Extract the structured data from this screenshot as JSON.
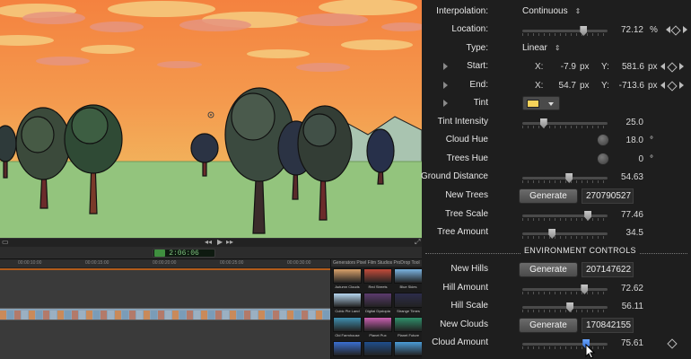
{
  "viewer": {
    "timecode": "2:06:06",
    "playback_controls": [
      "◂◂",
      "▶",
      "▸▸"
    ]
  },
  "timeline": {
    "ruler_labels": [
      "00:00:10:00",
      "00:00:15:00",
      "00:00:20:00",
      "00:00:25:00",
      "00:00:30:00"
    ]
  },
  "browser": {
    "header": "Generators   Pixel Film Studios   ProDrop Tool",
    "items": [
      {
        "label": "Autumn Clouds",
        "color": "#d9a16a"
      },
      {
        "label": "Red Streets",
        "color": "#c24b3a"
      },
      {
        "label": "Blue Skies",
        "color": "#7ab3e0"
      },
      {
        "label": "Cubic Pie Land",
        "color": "#b7d7f0"
      },
      {
        "label": "Digital Dystopia",
        "color": "#5b3b6e"
      },
      {
        "label": "Strange Times",
        "color": "#2c2c4a"
      },
      {
        "label": "Old Farmhouse",
        "color": "#3f8fb0"
      },
      {
        "label": "Planet Pux",
        "color": "#c95fb0"
      },
      {
        "label": "Planet Future",
        "color": "#2f8f6a"
      },
      {
        "label": "",
        "color": "#3a6fd0"
      },
      {
        "label": "",
        "color": "#1f4e8c"
      },
      {
        "label": "",
        "color": "#4a9bd6"
      }
    ]
  },
  "inspector": {
    "interpolation": {
      "label": "Interpolation:",
      "value": "Continuous"
    },
    "location": {
      "label": "Location:",
      "value": "72.12",
      "unit": "%",
      "fraction": 0.72
    },
    "type": {
      "label": "Type:",
      "value": "Linear"
    },
    "start": {
      "label": "Start:",
      "x_label": "X:",
      "x": "-7.9",
      "x_unit": "px",
      "y_label": "Y:",
      "y": "581.6",
      "y_unit": "px"
    },
    "end": {
      "label": "End:",
      "x_label": "X:",
      "x": "54.7",
      "x_unit": "px",
      "y_label": "Y:",
      "y": "-713.6",
      "y_unit": "px"
    },
    "tint": {
      "label": "Tint",
      "color": "#f7d35a"
    },
    "tint_intensity": {
      "label": "Tint Intensity",
      "value": "25.0",
      "fraction": 0.25
    },
    "cloud_hue": {
      "label": "Cloud Hue",
      "value": "18.0",
      "unit": "°"
    },
    "trees_hue": {
      "label": "Trees Hue",
      "value": "0",
      "unit": "°"
    },
    "ground_distance": {
      "label": "Ground Distance",
      "value": "54.63",
      "fraction": 0.55
    },
    "new_trees": {
      "label": "New Trees",
      "button": "Generate",
      "seed": "270790527"
    },
    "tree_scale": {
      "label": "Tree Scale",
      "value": "77.46",
      "fraction": 0.77
    },
    "tree_amount": {
      "label": "Tree Amount",
      "value": "34.5",
      "fraction": 0.35
    },
    "section_title": "ENVIRONMENT CONTROLS",
    "new_hills": {
      "label": "New Hills",
      "button": "Generate",
      "seed": "207147622"
    },
    "hill_amount": {
      "label": "Hill Amount",
      "value": "72.62",
      "fraction": 0.73
    },
    "hill_scale": {
      "label": "Hill Scale",
      "value": "56.11",
      "fraction": 0.56
    },
    "new_clouds": {
      "label": "New Clouds",
      "button": "Generate",
      "seed": "170842155"
    },
    "cloud_amount": {
      "label": "Cloud Amount",
      "value": "75.61",
      "fraction": 0.75
    }
  },
  "colors": {
    "sky_top": "#f58a4a",
    "sky_bottom": "#f2b05c",
    "ground": "#93c47d",
    "accent_blue": "#2d63c8"
  }
}
